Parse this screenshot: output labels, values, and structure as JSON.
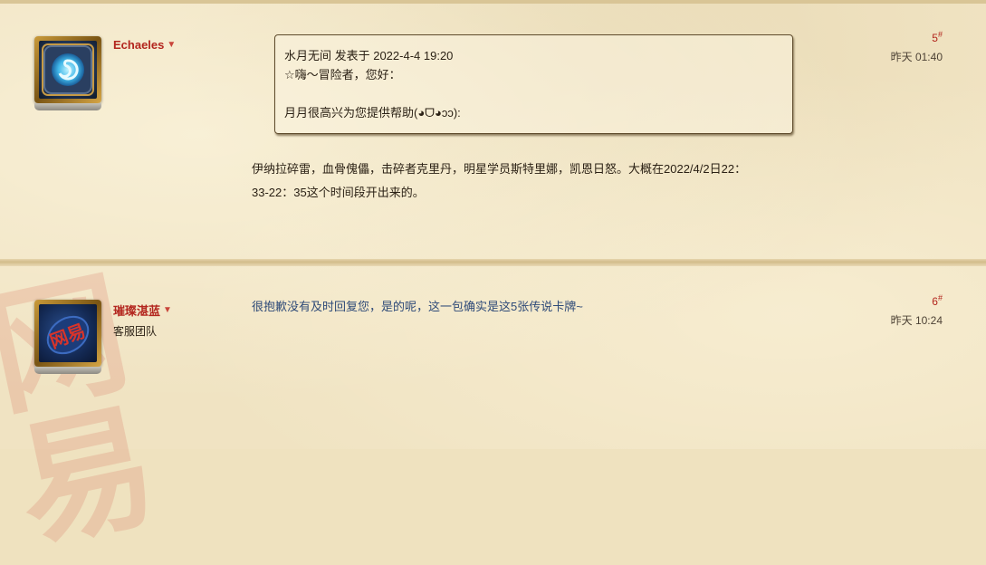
{
  "posts": [
    {
      "username": "Echaeles",
      "floor": "5",
      "time": "昨天 01:40",
      "quote": {
        "header": "水月无间 发表于 2022-4-4 19:20",
        "lines": [
          "☆嗨～冒险者，您好：",
          "",
          "月月很高兴为您提供帮助(◕ᗜ◕ↄↄ):"
        ]
      },
      "body": [
        "伊纳拉碎雷，血骨傀儡，击碎者克里丹，明星学员斯特里娜，凯恩日怒。大概在2022/4/2日22：",
        "33-22：35这个时间段开出来的。"
      ]
    },
    {
      "username": "璀璨湛蓝",
      "role": "客服团队",
      "floor": "6",
      "time": "昨天 10:24",
      "body": "很抱歉没有及时回复您，是的呢，这一包确实是这5张传说卡牌~",
      "avatar_text": "网易"
    }
  ],
  "watermark_text": "网易",
  "icons": {
    "user_menu": "chevron-down-icon",
    "avatar1": "hearthstone-emblem-icon",
    "avatar2": "netease-logo-icon"
  }
}
